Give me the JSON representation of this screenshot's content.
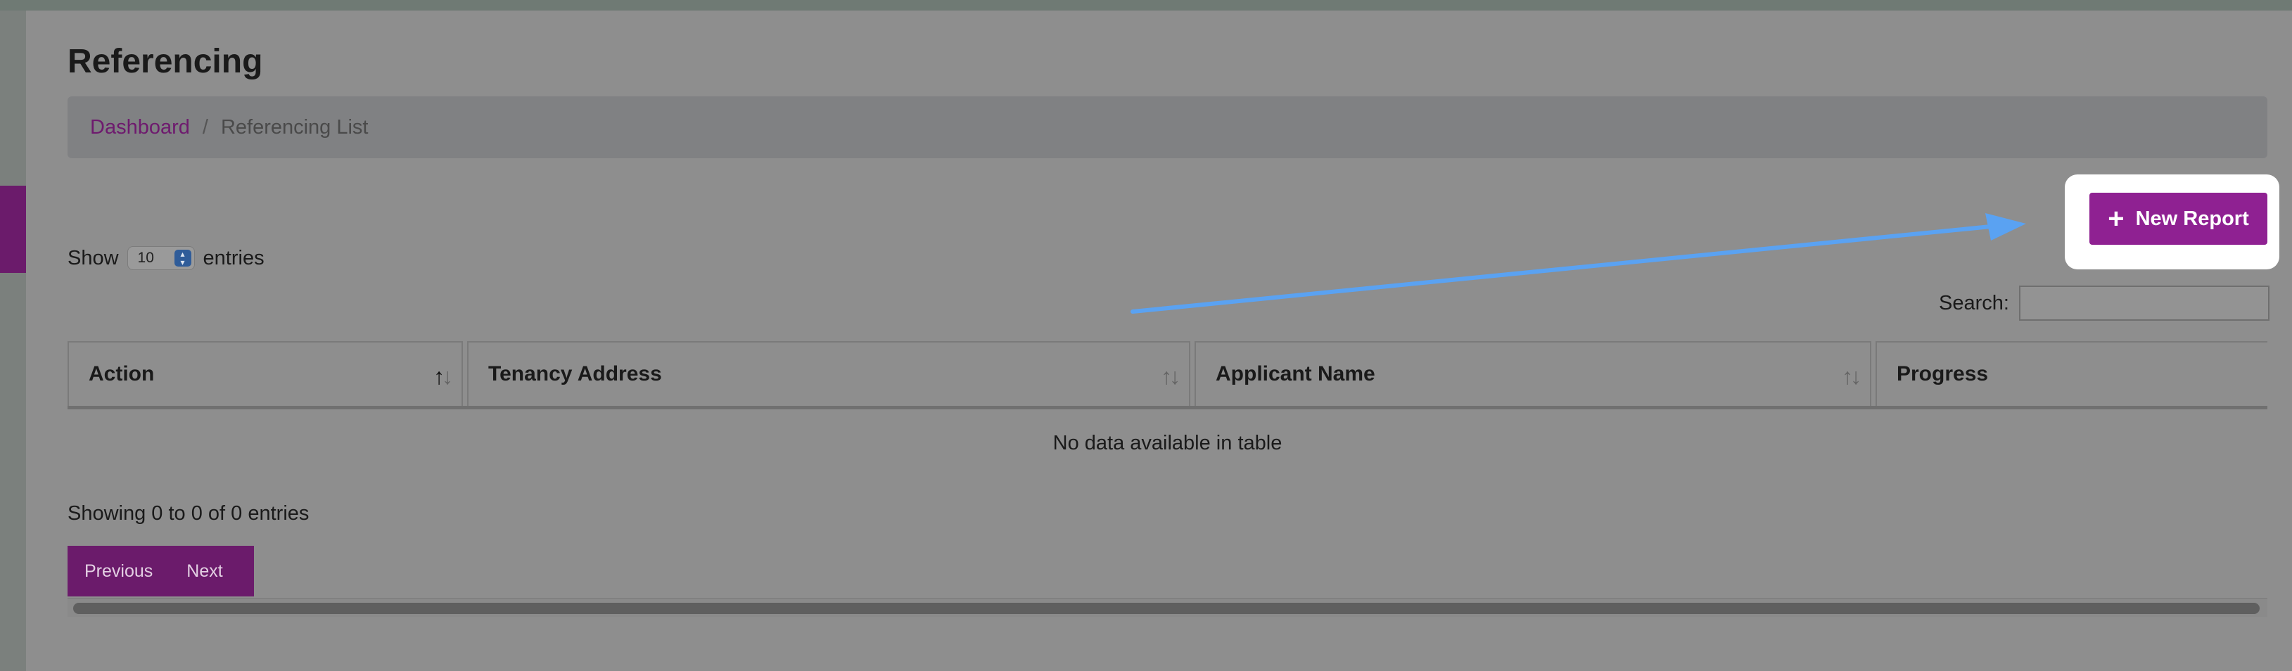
{
  "page": {
    "title": "Referencing"
  },
  "breadcrumb": {
    "home": "Dashboard",
    "separator": "/",
    "current": "Referencing List"
  },
  "length": {
    "prefix": "Show",
    "value": "10",
    "suffix": "entries"
  },
  "actions": {
    "new_report": "New Report",
    "plus": "+"
  },
  "search": {
    "label": "Search:",
    "value": "",
    "placeholder": ""
  },
  "table": {
    "columns": [
      {
        "label": "Action"
      },
      {
        "label": "Tenancy Address"
      },
      {
        "label": "Applicant Name"
      },
      {
        "label": "Progress"
      }
    ],
    "empty_message": "No data available in table"
  },
  "info": {
    "text": "Showing 0 to 0 of 0 entries"
  },
  "pagination": {
    "previous": "Previous",
    "next": "Next"
  },
  "colors": {
    "accent": "#8f2192",
    "annotation_arrow": "#5aa2f2"
  }
}
